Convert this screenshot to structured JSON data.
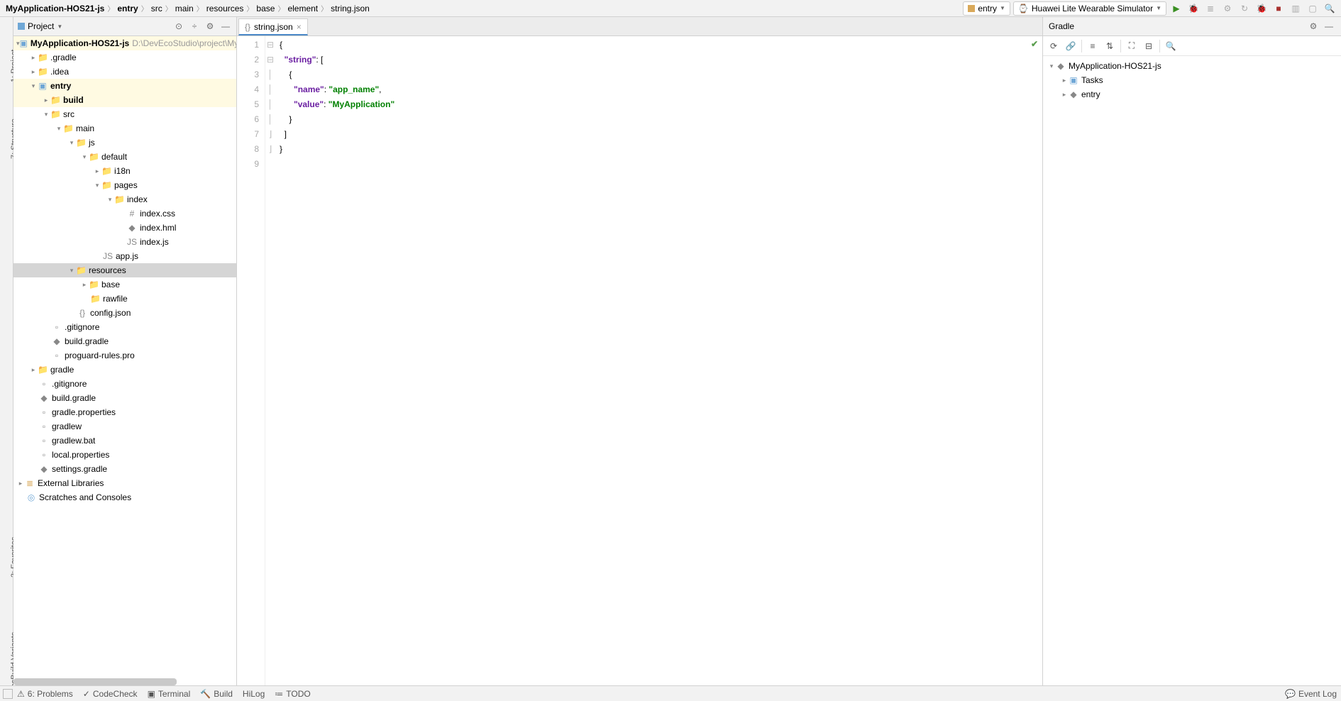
{
  "breadcrumb": [
    "MyApplication-HOS21-js",
    "entry",
    "src",
    "main",
    "resources",
    "base",
    "element",
    "string.json"
  ],
  "run": {
    "module_label": "entry",
    "device_label": "Huawei Lite Wearable Simulator"
  },
  "project_header": {
    "title": "Project"
  },
  "editor_tab": {
    "label": "string.json"
  },
  "gradle_header": {
    "title": "Gradle"
  },
  "left_gutter": {
    "project": "1: Project",
    "structure": "7: Structure",
    "favorites": "2: Favorites",
    "variants": "OhosBuild Variants"
  },
  "tree": {
    "root": "MyApplication-HOS21-js",
    "root_path": "D:\\DevEcoStudio\\project\\MyAp",
    "gradle_dir": ".gradle",
    "idea_dir": ".idea",
    "entry": "entry",
    "build": "build",
    "src": "src",
    "main": "main",
    "js": "js",
    "default": "default",
    "i18n": "i18n",
    "pages": "pages",
    "index": "index",
    "index_css": "index.css",
    "index_hml": "index.hml",
    "index_js": "index.js",
    "app_js": "app.js",
    "resources": "resources",
    "base": "base",
    "rawfile": "rawfile",
    "config_json": "config.json",
    "gitignore1": ".gitignore",
    "build_gradle1": "build.gradle",
    "proguard": "proguard-rules.pro",
    "gradle_root": "gradle",
    "gitignore2": ".gitignore",
    "build_gradle2": "build.gradle",
    "gradle_props": "gradle.properties",
    "gradlew": "gradlew",
    "gradlew_bat": "gradlew.bat",
    "local_props": "local.properties",
    "settings_gradle": "settings.gradle",
    "ext_libs": "External Libraries",
    "scratches": "Scratches and Consoles"
  },
  "code": {
    "lines": [
      "{",
      "  \"string\": [",
      "    {",
      "      \"name\": \"app_name\",",
      "      \"value\": \"MyApplication\"",
      "    }",
      "  ]",
      "}",
      ""
    ],
    "line_numbers": [
      "1",
      "2",
      "3",
      "4",
      "5",
      "6",
      "7",
      "8",
      "9"
    ]
  },
  "gradle_tree": {
    "root": "MyApplication-HOS21-js",
    "tasks": "Tasks",
    "entry": "entry"
  },
  "status": {
    "problems": "6: Problems",
    "codecheck": "CodeCheck",
    "terminal": "Terminal",
    "build": "Build",
    "hilog": "HiLog",
    "todo": "TODO",
    "eventlog": "Event Log"
  }
}
